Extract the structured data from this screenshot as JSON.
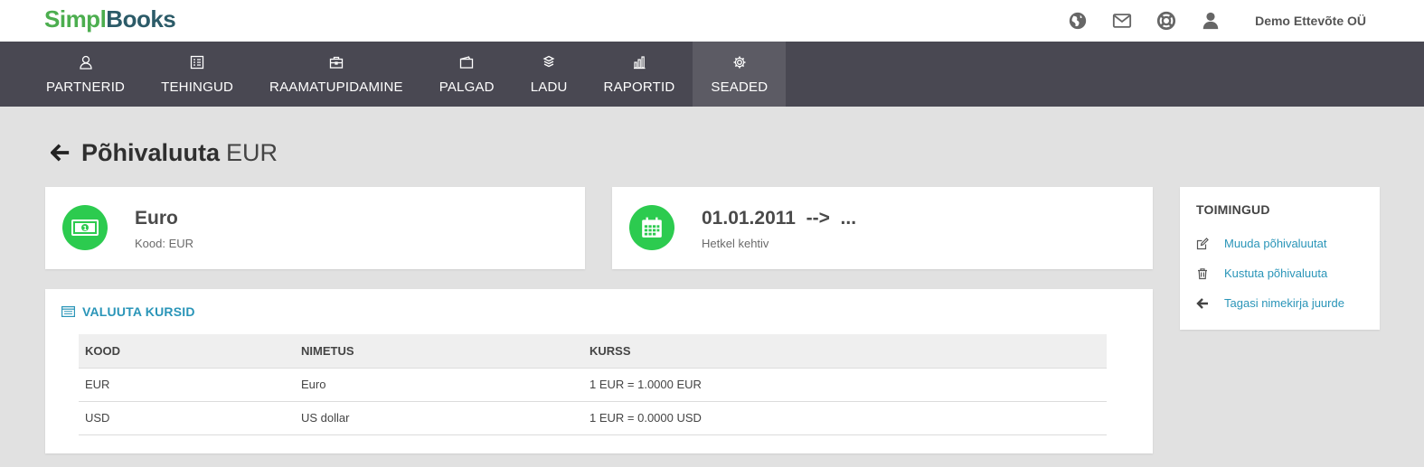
{
  "brand": {
    "part1": "Simpl",
    "part2": "Books"
  },
  "header": {
    "company": "Demo Ettevõte OÜ",
    "icons": [
      "globe-icon",
      "mail-icon",
      "help-lifebuoy-icon",
      "user-icon"
    ]
  },
  "nav": {
    "items": [
      {
        "label": "PARTNERID",
        "icon": "person-icon"
      },
      {
        "label": "TEHINGUD",
        "icon": "document-list-icon"
      },
      {
        "label": "RAAMATUPIDAMINE",
        "icon": "briefcase-icon"
      },
      {
        "label": "PALGAD",
        "icon": "wallet-icon"
      },
      {
        "label": "LADU",
        "icon": "boxes-icon"
      },
      {
        "label": "RAPORTID",
        "icon": "bar-chart-icon"
      },
      {
        "label": "SEADED",
        "icon": "gear-icon",
        "active": true
      }
    ]
  },
  "page": {
    "title": "Põhivaluuta",
    "subtitle": "EUR"
  },
  "currency_card": {
    "name": "Euro",
    "code_text": "Kood: EUR"
  },
  "validity_card": {
    "range": "01.01.2011  -->  ...",
    "status": "Hetkel kehtiv"
  },
  "rates": {
    "section_title": "VALUUTA KURSID",
    "columns": [
      "KOOD",
      "NIMETUS",
      "KURSS"
    ],
    "rows": [
      {
        "code": "EUR",
        "name": "Euro",
        "rate": "1 EUR = 1.0000 EUR"
      },
      {
        "code": "USD",
        "name": "US dollar",
        "rate": "1 EUR = 0.0000 USD"
      }
    ]
  },
  "actions": {
    "title": "TOIMINGUD",
    "items": [
      {
        "label": "Muuda põhivaluutat",
        "icon": "edit-icon"
      },
      {
        "label": "Kustuta põhivaluuta",
        "icon": "trash-icon"
      },
      {
        "label": "Tagasi nimekirja juurde",
        "icon": "arrow-left-icon"
      }
    ]
  },
  "colors": {
    "accent_green": "#2ccb4f",
    "link_blue": "#2a95b8",
    "nav_bg": "#494852",
    "logo_green": "#4cae4f",
    "logo_dark": "#2c5b68"
  }
}
